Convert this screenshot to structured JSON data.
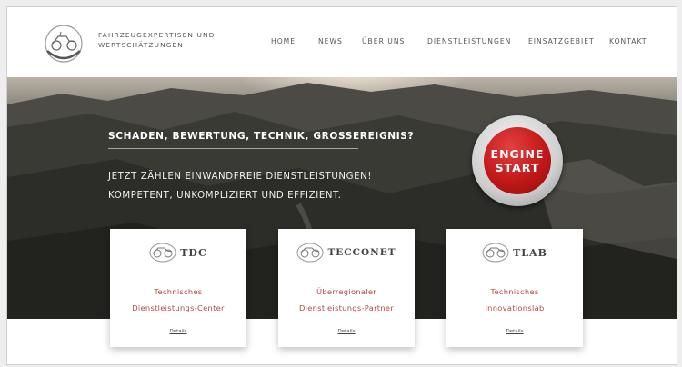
{
  "header": {
    "brand_line1": "FAHRZEUGEXPERTISEN UND",
    "brand_line2": "WERTSCHÄTZUNGEN",
    "nav": [
      "HOME",
      "NEWS",
      "ÜBER UNS",
      "DIENSTLEISTUNGEN",
      "EINSATZGEBIET",
      "KONTAKT"
    ]
  },
  "hero": {
    "headline": "SCHADEN, BEWERTUNG, TECHNIK, GROSSEREIGNIS?",
    "subline1": "JETZT ZÄHLEN EINWANDFREIE DIENSTLEISTUNGEN!",
    "subline2": "KOMPETENT, UNKOMPLIZIERT UND EFFIZIENT.",
    "button_line1": "ENGINE",
    "button_line2": "START"
  },
  "cards": [
    {
      "logo": "TDC",
      "title_line1": "Technisches",
      "title_line2": "Dienstleistungs-Center",
      "link": "Details"
    },
    {
      "logo": "TECCONET",
      "title_line1": "Überregionaler",
      "title_line2": "Dienstleistungs-Partner",
      "link": "Details"
    },
    {
      "logo": "TLAB",
      "title_line1": "Technisches",
      "title_line2": "Innovationslab",
      "link": "Details"
    }
  ],
  "colors": {
    "accent": "#c21818",
    "card_title": "#b34747"
  },
  "icons": {
    "logo": "vintage-car-icon"
  }
}
